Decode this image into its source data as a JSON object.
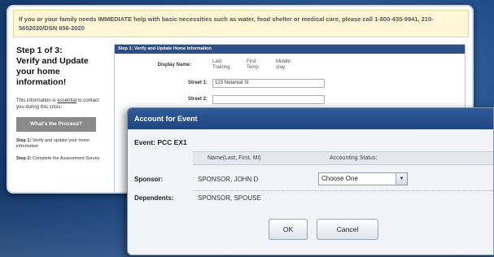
{
  "banner": {
    "text": "If you or your family needs IMMEDIATE help with basic necessities such as water, food shelter or medical care, please call 1-800-435-9941, 210-5652020/DSN 656-2020"
  },
  "left": {
    "step": "Step 1 of 3:",
    "heading_line1": "Verify and Update",
    "heading_line2": "your home",
    "heading_line3": "information!",
    "info_pre": "This information is ",
    "info_link": "essential",
    "info_post": " to contact you during this crisis.",
    "process_button": "What's the Process?",
    "step1_bold": "Step 1:",
    "step1_text": " Verify and update your home information",
    "step2_bold": "Step 2:",
    "step2_text": " Complete the Assessment Survey"
  },
  "form": {
    "header": "Step 1: Verify and Update Home Information",
    "display_name_label": "Display Name:",
    "last_col": "Last Training",
    "first_col": "First Temp",
    "middle_col": "Middle: stay",
    "street1_label": "Street 1:",
    "street1_value": "123 Notareal St",
    "street2_label": "Street 2:",
    "street2_value": ""
  },
  "dialog": {
    "title": "Account for Event",
    "event_label": "Event: PCC EX1",
    "col_name": "Name(Last, First, MI)",
    "col_status": "Accounting Status:",
    "sponsor_label": "Sponsor:",
    "sponsor_name": "SPONSOR, JOHN D",
    "status_selected": "Choose One",
    "dependents_label": "Dependents:",
    "dependent_name": "SPONSOR, SPOUSE",
    "ok_label": "OK",
    "cancel_label": "Cancel"
  }
}
